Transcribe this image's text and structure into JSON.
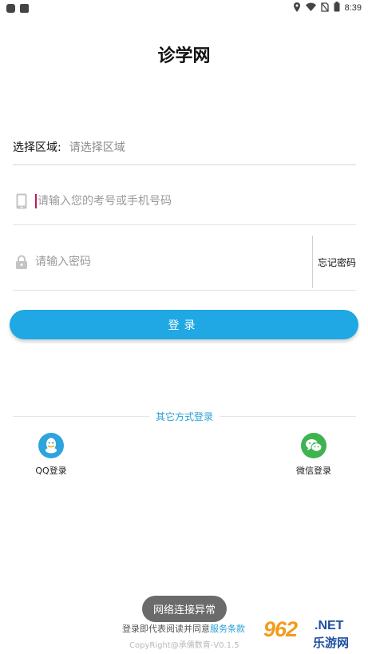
{
  "status_bar": {
    "time": "8:39"
  },
  "app": {
    "title": "诊学网"
  },
  "form": {
    "region_label": "选择区域:",
    "region_placeholder": "请选择区域",
    "account_placeholder": "请输入您的考号或手机号码",
    "password_placeholder": "请输入密码",
    "forgot_label": "忘记密码",
    "login_label": "登录"
  },
  "other_login": {
    "title": "其它方式登录",
    "qq_label": "QQ登录",
    "wechat_label": "微信登录"
  },
  "toast": {
    "text": "网络连接异常"
  },
  "footer": {
    "agreement_prefix": "登录即代表阅读并同意",
    "agreement_link": "服务条款",
    "copyright": "CopyRight@承儒数育-V0.1.5"
  },
  "watermark": {
    "number": "962",
    "net": ".NET",
    "site": "乐游网"
  },
  "colors": {
    "accent": "#1fa8e4",
    "qq": "#2ea4dd",
    "wechat": "#3eb34f",
    "link": "#2a9fd6"
  }
}
